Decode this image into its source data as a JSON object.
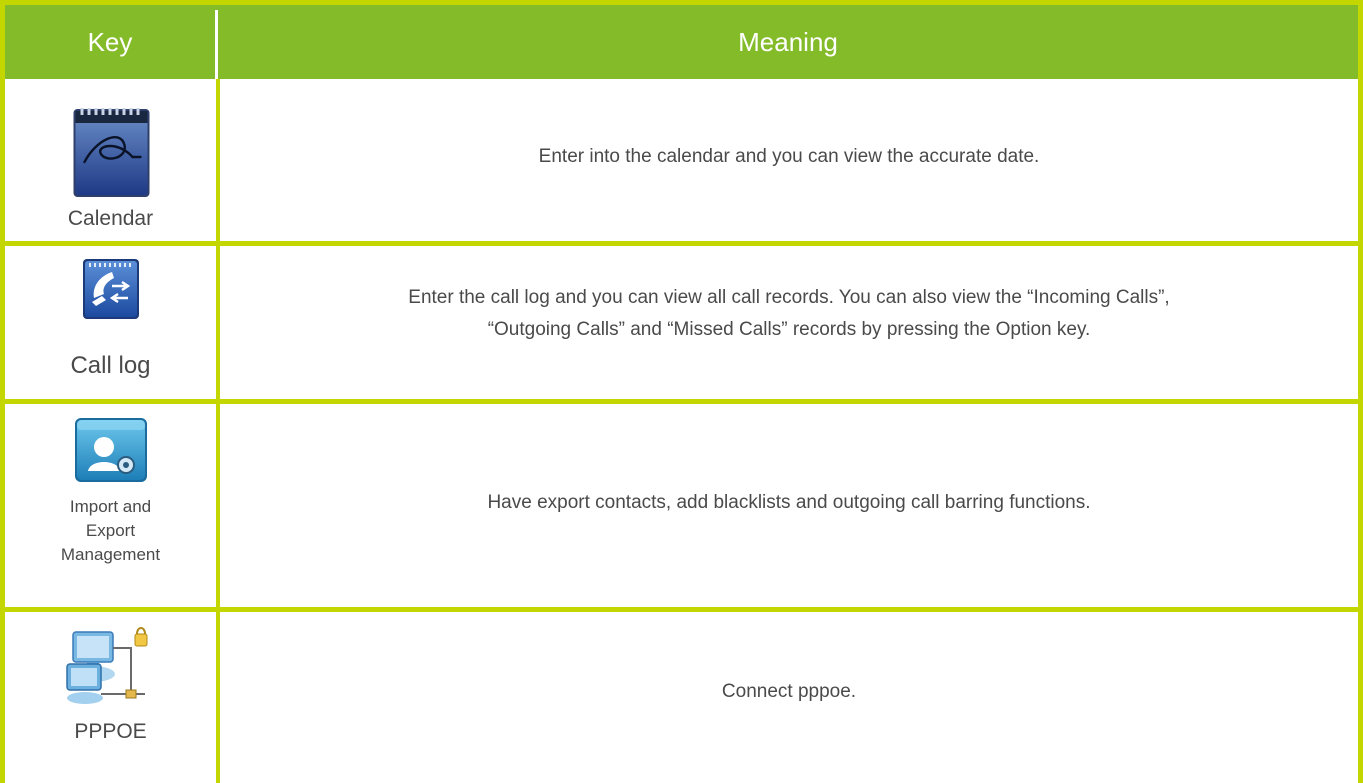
{
  "header": {
    "key": "Key",
    "meaning": "Meaning"
  },
  "rows": [
    {
      "icon": "calendar-icon",
      "key_label": "Calendar",
      "meaning": "Enter into the calendar and you can view the accurate date."
    },
    {
      "icon": "call-log-icon",
      "key_label": "Call log",
      "meaning_lines": [
        "Enter the call log and you can view all call records. You can also view the “Incoming Calls”,",
        "“Outgoing Calls” and “Missed Calls” records by pressing the Option  key."
      ]
    },
    {
      "icon": "import-export-contacts-icon",
      "key_label_lines": [
        "Import and",
        "Export",
        "Management"
      ],
      "meaning": "Have export contacts, add blacklists and outgoing call barring functions."
    },
    {
      "icon": "pppoe-network-icon",
      "key_label": "PPPOE",
      "meaning": "Connect pppoe."
    }
  ],
  "colors": {
    "header_bg": "#84bb29",
    "border": "#c4d600",
    "text": "#4a4a4a"
  }
}
